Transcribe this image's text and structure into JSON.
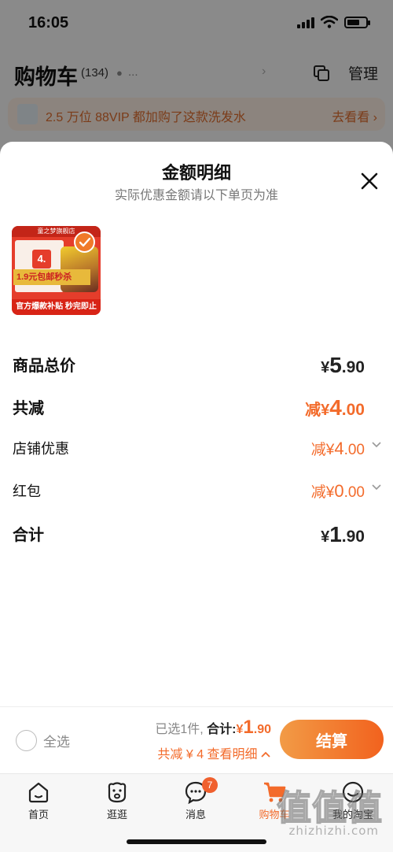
{
  "status_bar": {
    "time": "16:05"
  },
  "cart_header": {
    "title": "购物车",
    "count": "(134)",
    "location": "...",
    "manage": "管理"
  },
  "promo": {
    "text": "2.5 万位 88VIP 都加购了这款洗发水",
    "link": "去看看"
  },
  "sheet": {
    "title": "金额明细",
    "subtitle": "实际优惠金额请以下单页为准",
    "product": {
      "shop_name": "童之梦旗舰店",
      "badge_number": "4.",
      "promo_strip": "1.9元包邮秒杀",
      "ribbon": "官方爆款补贴 秒完即止"
    },
    "rows": [
      {
        "label": "商品总价",
        "currency": "¥",
        "int": "5",
        "dec": ".90"
      },
      {
        "label": "共减",
        "prefix": "减",
        "currency": "¥",
        "int": "4",
        "dec": ".00"
      },
      {
        "label": "店铺优惠",
        "prefix": "减",
        "currency": "¥",
        "int": "4",
        "dec": ".00"
      },
      {
        "label": "红包",
        "prefix": "减",
        "currency": "¥",
        "int": "0",
        "dec": ".00"
      },
      {
        "label": "合计",
        "currency": "¥",
        "int": "1",
        "dec": ".90"
      }
    ]
  },
  "checkout": {
    "select_all": "全选",
    "selected": "已选1件,",
    "total_label": "合计:",
    "total_currency": "¥",
    "total_int": "1",
    "total_dec": ".90",
    "discount_line": "共减 ¥ 4 查看明细",
    "pay_button": "结算"
  },
  "tabs": [
    {
      "label": "首页",
      "icon": "home-icon"
    },
    {
      "label": "逛逛",
      "icon": "browse-icon"
    },
    {
      "label": "消息",
      "icon": "message-icon",
      "badge": "7"
    },
    {
      "label": "购物车",
      "icon": "cart-icon",
      "active": true
    },
    {
      "label": "我的淘宝",
      "icon": "profile-icon"
    }
  ],
  "watermark": {
    "glyphs": "值",
    "url": "zhizhizhi.com"
  },
  "colors": {
    "accent": "#f36b2b",
    "promo_bg": "#f7e8de"
  }
}
